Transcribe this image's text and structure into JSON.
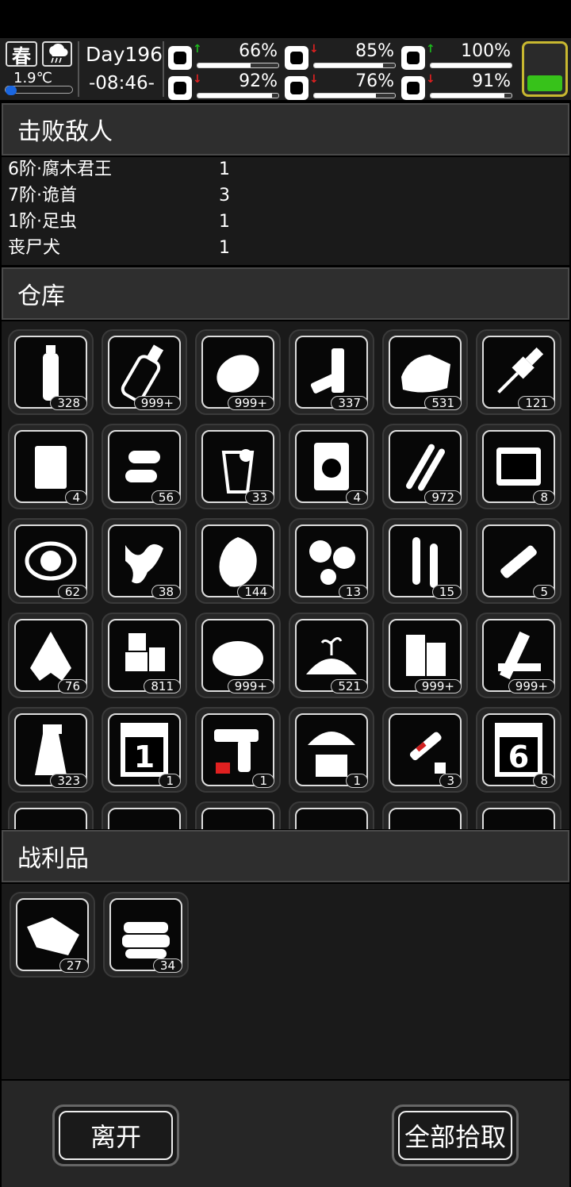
{
  "hud": {
    "season": "春",
    "temperature": "1.9℃",
    "day": "Day196",
    "time": "-08:46-",
    "stats": [
      {
        "name": "health",
        "icon": "medkit-icon",
        "trend": "up",
        "value": "66%",
        "level": 0.66
      },
      {
        "name": "hunger",
        "icon": "stomach-icon",
        "trend": "down",
        "value": "85%",
        "level": 0.85
      },
      {
        "name": "mood",
        "icon": "helmet-icon",
        "trend": "up",
        "value": "100%",
        "level": 1.0
      },
      {
        "name": "stamina",
        "icon": "leg-icon",
        "trend": "down",
        "value": "92%",
        "level": 0.92
      },
      {
        "name": "thirst",
        "icon": "water-drop-icon",
        "trend": "down",
        "value": "76%",
        "level": 0.76
      },
      {
        "name": "heart",
        "icon": "heart-icon",
        "trend": "down",
        "value": "91%",
        "level": 0.91
      }
    ],
    "battery_level": 0.35,
    "colors": {
      "up": "#1db91d",
      "down": "#e02020",
      "battery": "#37c21a",
      "battery_border": "#c8b830"
    }
  },
  "defeated": {
    "title": "击败敌人",
    "rows": [
      {
        "name": "6阶·腐木君王",
        "count": "1"
      },
      {
        "name": "7阶·诡首",
        "count": "3"
      },
      {
        "name": "1阶·足虫",
        "count": "1"
      },
      {
        "name": "丧尸犬",
        "count": "1"
      }
    ]
  },
  "warehouse": {
    "title": "仓库",
    "items": [
      {
        "icon": "water-bottle-icon",
        "count": "328"
      },
      {
        "icon": "glass-bottle-icon",
        "count": "999+"
      },
      {
        "icon": "potato-icon",
        "count": "999+"
      },
      {
        "icon": "battery-icon",
        "count": "337"
      },
      {
        "icon": "cloth-icon",
        "count": "531"
      },
      {
        "icon": "spark-plug-icon",
        "count": "121"
      },
      {
        "icon": "book-icon",
        "count": "4"
      },
      {
        "icon": "bullets-icon",
        "count": "56"
      },
      {
        "icon": "juice-icon",
        "count": "33"
      },
      {
        "icon": "snack-bag-icon",
        "count": "4"
      },
      {
        "icon": "rifle-ammo-icon",
        "count": "972"
      },
      {
        "icon": "toolbox-icon",
        "count": "8"
      },
      {
        "icon": "gas-mask-icon",
        "count": "62"
      },
      {
        "icon": "ginger-icon",
        "count": "38"
      },
      {
        "icon": "herb-icon",
        "count": "144"
      },
      {
        "icon": "pills-icon",
        "count": "13"
      },
      {
        "icon": "ampoule-icon",
        "count": "15"
      },
      {
        "icon": "syringe-icon",
        "count": "5"
      },
      {
        "icon": "torn-cloth-icon",
        "count": "76"
      },
      {
        "icon": "ice-icon",
        "count": "811"
      },
      {
        "icon": "fiber-pile-icon",
        "count": "999+"
      },
      {
        "icon": "soil-pile-icon",
        "count": "521"
      },
      {
        "icon": "wood-blocks-icon",
        "count": "999+"
      },
      {
        "icon": "planks-icon",
        "count": "999+"
      },
      {
        "icon": "spray-bottle-icon",
        "count": "323"
      },
      {
        "icon": "lv1-card-icon",
        "count": "1",
        "label": "1"
      },
      {
        "icon": "flare-gun-icon",
        "count": "1"
      },
      {
        "icon": "airdrop-icon",
        "count": "1"
      },
      {
        "icon": "adrenaline-icon",
        "count": "3"
      },
      {
        "icon": "lv6-card-icon",
        "count": "8",
        "label": "6"
      }
    ]
  },
  "loot": {
    "title": "战利品",
    "items": [
      {
        "icon": "meat-icon",
        "count": "27"
      },
      {
        "icon": "folded-cloth-icon",
        "count": "34"
      }
    ]
  },
  "actions": {
    "leave": "离开",
    "take_all": "全部拾取"
  }
}
